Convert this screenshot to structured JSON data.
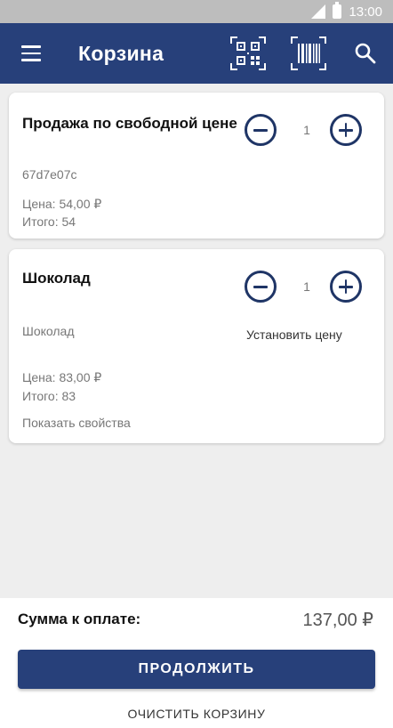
{
  "status_bar": {
    "time": "13:00"
  },
  "app_bar": {
    "title": "Корзина"
  },
  "cart": {
    "items": [
      {
        "name": "Продажа по свободной цене",
        "code": "67d7e07c",
        "price_line": "Цена: 54,00 ₽",
        "total_line": "Итого: 54",
        "quantity": "1"
      },
      {
        "name": "Шоколад",
        "description": "Шоколад",
        "set_price_label": "Установить цену",
        "price_line": "Цена: 83,00 ₽",
        "total_line": "Итого: 83",
        "show_properties_label": "Показать свойства",
        "quantity": "1"
      }
    ]
  },
  "summary": {
    "label": "Сумма к оплате:",
    "amount": "137,00 ₽"
  },
  "actions": {
    "continue_label": "ПРОДОЛЖИТЬ",
    "clear_label": "ОЧИСТИТЬ КОРЗИНУ"
  },
  "colors": {
    "primary": "#27407a",
    "accent_icon": "#1f3566",
    "background": "#eeeeee"
  }
}
